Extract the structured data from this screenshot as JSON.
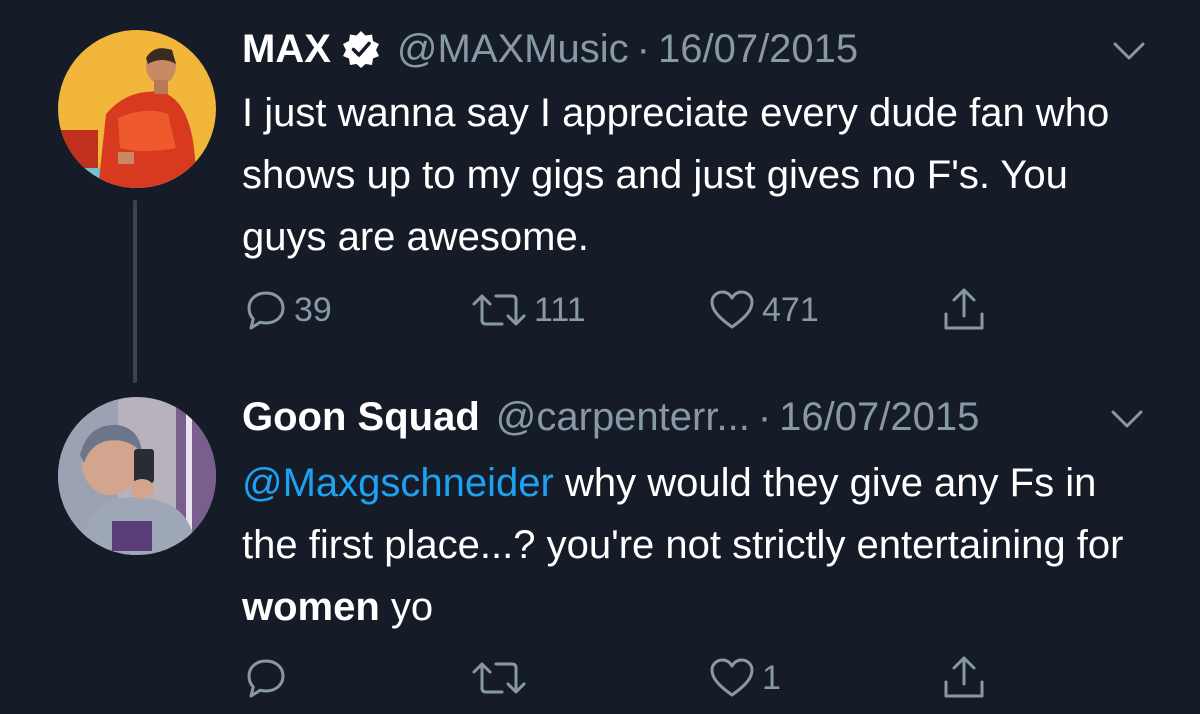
{
  "thread": {
    "tweets": [
      {
        "name": "MAX",
        "verified": true,
        "handle": "@MAXMusic",
        "separator": "·",
        "date": "16/07/2015",
        "text": "I just wanna say I appreciate every dude fan who shows up to my gigs and just gives no F's. You guys are awesome.",
        "replies": "39",
        "retweets": "111",
        "likes": "471"
      },
      {
        "name": "Goon Squad",
        "verified": false,
        "handle": "@carpenterr...",
        "separator": "·",
        "date": "16/07/2015",
        "text_parts": {
          "mention": "@Maxgschneider",
          "body": " why would they give any Fs in the first place...? you're not strictly entertaining for ",
          "bold": "women",
          "tail": " yo"
        },
        "replies": "",
        "retweets": "",
        "likes": "1"
      }
    ]
  },
  "icons": {
    "reply": "speech-bubble-icon",
    "retweet": "retweet-icon",
    "like": "heart-icon",
    "share": "share-icon",
    "more": "chevron-down-icon",
    "verified": "verified-badge-icon"
  },
  "colors": {
    "background": "#151c27",
    "text": "#ffffff",
    "muted": "#8899a6",
    "mention": "#1da1f2"
  }
}
